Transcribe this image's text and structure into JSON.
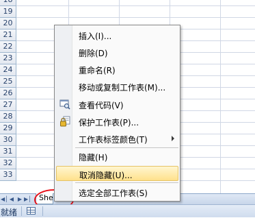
{
  "rows": [
    "18",
    "19",
    "20",
    "21",
    "22",
    "23",
    "24",
    "25",
    "26",
    "27",
    "28",
    "29",
    "30",
    "31",
    "32",
    "33"
  ],
  "context_menu": {
    "items": [
      {
        "label": "插入(I)...",
        "icon": null,
        "submenu": false
      },
      {
        "label": "删除(D)",
        "icon": null,
        "submenu": false
      },
      {
        "label": "重命名(R)",
        "icon": null,
        "submenu": false
      },
      {
        "label": "移动或复制工作表(M)...",
        "icon": null,
        "submenu": false
      },
      {
        "label": "查看代码(V)",
        "icon": "view-code-icon",
        "submenu": false
      },
      {
        "label": "保护工作表(P)...",
        "icon": "protect-sheet-icon",
        "submenu": false
      },
      {
        "label": "工作表标签颜色(T)",
        "icon": null,
        "submenu": true
      },
      {
        "label": "隐藏(H)",
        "icon": null,
        "submenu": false
      },
      {
        "label": "取消隐藏(U)...",
        "icon": null,
        "submenu": false,
        "highlighted": true
      },
      {
        "label": "选定全部工作表(S)",
        "icon": null,
        "submenu": false
      }
    ]
  },
  "tabs": {
    "nav_icons": [
      "first-sheet-icon",
      "prev-sheet-icon",
      "next-sheet-icon",
      "last-sheet-icon"
    ],
    "active_tab_label": "She"
  },
  "status": {
    "mode_text": "就绪",
    "icon": "macro-record-icon"
  },
  "colors": {
    "highlight": "#ffe18c",
    "annotation_ellipse": "#e8141c",
    "row_header_text": "#27416b"
  }
}
